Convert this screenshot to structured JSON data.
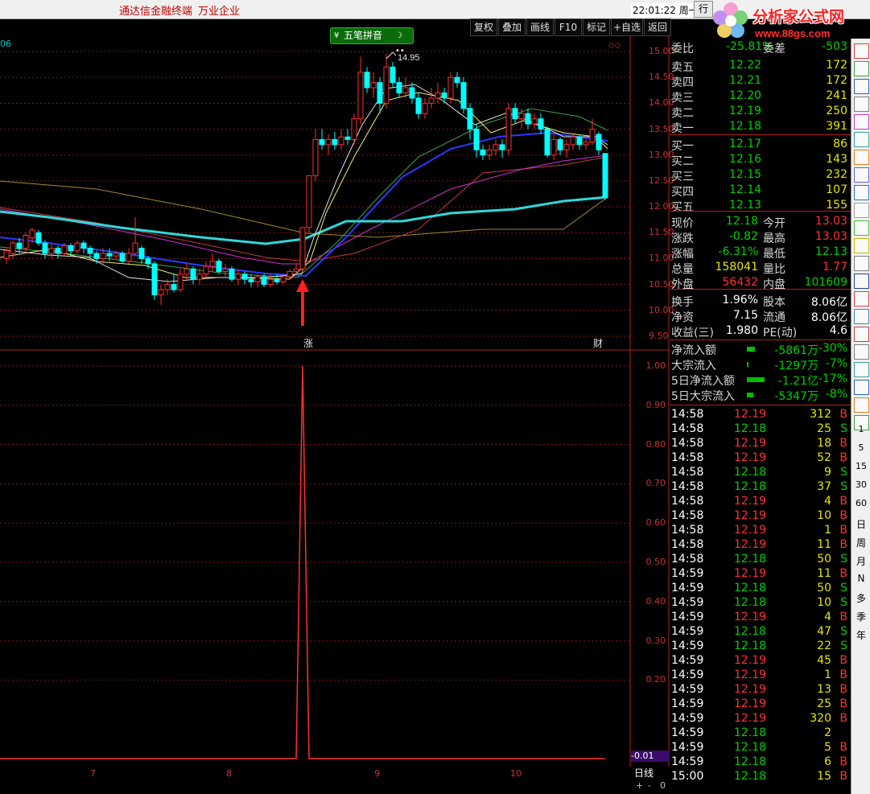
{
  "titlebar": {
    "app_name": "通达信金融终端",
    "stock_name": "万业企业",
    "clock": "22:01:22 周一",
    "trade_button": "行"
  },
  "logo": {
    "name": "分析家公式网",
    "url_text": "www.88gs.com"
  },
  "toolbar": {
    "buttons": [
      "复权",
      "叠加",
      "画线",
      "F10",
      "标记",
      "+自选",
      "返回"
    ]
  },
  "pinyin_box": {
    "label": "五笔拼音"
  },
  "indicator_value_top": "06",
  "price_axis": [
    "15.00",
    "14.50",
    "14.00",
    "13.50",
    "13.00",
    "12.50",
    "12.00",
    "11.50",
    "11.00",
    "10.50",
    "10.00",
    "9.50"
  ],
  "peak_label": "14.95",
  "signal_label": "涨",
  "cai_label": "财",
  "indicator_axis": [
    "1.00",
    "0.90",
    "0.80",
    "0.70",
    "0.60",
    "0.50",
    "0.40",
    "0.30",
    "0.20"
  ],
  "indicator_current": "-0.01",
  "date_labels": [
    "7",
    "8",
    "9",
    "10"
  ],
  "period_label": "日线",
  "zoom_controls": [
    "+",
    "-",
    "0"
  ],
  "quote": {
    "wei_bi": {
      "label": "委比",
      "value": "-25.81%",
      "label2": "委差",
      "value2": "-503"
    },
    "asks": [
      {
        "label": "卖五",
        "price": "12.22",
        "vol": "172"
      },
      {
        "label": "卖四",
        "price": "12.21",
        "vol": "172"
      },
      {
        "label": "卖三",
        "price": "12.20",
        "vol": "241"
      },
      {
        "label": "卖二",
        "price": "12.19",
        "vol": "250"
      },
      {
        "label": "卖一",
        "price": "12.18",
        "vol": "391"
      }
    ],
    "bids": [
      {
        "label": "买一",
        "price": "12.17",
        "vol": "86"
      },
      {
        "label": "买二",
        "price": "12.16",
        "vol": "143"
      },
      {
        "label": "买三",
        "price": "12.15",
        "vol": "232"
      },
      {
        "label": "买四",
        "price": "12.14",
        "vol": "107"
      },
      {
        "label": "买五",
        "price": "12.13",
        "vol": "155"
      }
    ],
    "stats": [
      {
        "l1": "现价",
        "v1": "12.18",
        "l2": "今开",
        "v2": "13.03"
      },
      {
        "l1": "涨跌",
        "v1": "-0.82",
        "l2": "最高",
        "v2": "13.03"
      },
      {
        "l1": "涨幅",
        "v1": "-6.31%",
        "l2": "最低",
        "v2": "12.13"
      },
      {
        "l1": "总量",
        "v1": "158041",
        "l2": "量比",
        "v2": "1.77"
      },
      {
        "l1": "外盘",
        "v1": "56432",
        "l2": "内盘",
        "v2": "101609"
      }
    ],
    "fundamentals": [
      {
        "l1": "换手",
        "v1": "1.96%",
        "l2": "股本",
        "v2": "8.06亿"
      },
      {
        "l1": "净资",
        "v1": "7.15",
        "l2": "流通",
        "v2": "8.06亿"
      },
      {
        "l1": "收益(三)",
        "v1": "1.980",
        "l2": "PE(动)",
        "v2": "4.6"
      }
    ],
    "flows": [
      {
        "label": "净流入额",
        "value": "-5861万",
        "pct": "-30%"
      },
      {
        "label": "大宗流入",
        "value": "-1297万",
        "pct": "-7%"
      },
      {
        "label": "5日净流入额",
        "value": "-1.21亿",
        "pct": "-17%"
      },
      {
        "label": "5日大宗流入",
        "value": "-5347万",
        "pct": "-8%"
      }
    ]
  },
  "ticks": [
    {
      "t": "14:58",
      "p": "12.19",
      "v": "312",
      "s": "B"
    },
    {
      "t": "14:58",
      "p": "12.18",
      "v": "25",
      "s": "S"
    },
    {
      "t": "14:58",
      "p": "12.19",
      "v": "18",
      "s": "B"
    },
    {
      "t": "14:58",
      "p": "12.19",
      "v": "52",
      "s": "B"
    },
    {
      "t": "14:58",
      "p": "12.18",
      "v": "9",
      "s": "S"
    },
    {
      "t": "14:58",
      "p": "12.18",
      "v": "37",
      "s": "S"
    },
    {
      "t": "14:58",
      "p": "12.19",
      "v": "4",
      "s": "B"
    },
    {
      "t": "14:58",
      "p": "12.19",
      "v": "10",
      "s": "B"
    },
    {
      "t": "14:58",
      "p": "12.19",
      "v": "1",
      "s": "B"
    },
    {
      "t": "14:58",
      "p": "12.19",
      "v": "11",
      "s": "B"
    },
    {
      "t": "14:58",
      "p": "12.18",
      "v": "50",
      "s": "S"
    },
    {
      "t": "14:59",
      "p": "12.19",
      "v": "11",
      "s": "B"
    },
    {
      "t": "14:59",
      "p": "12.18",
      "v": "50",
      "s": "S"
    },
    {
      "t": "14:59",
      "p": "12.18",
      "v": "10",
      "s": "S"
    },
    {
      "t": "14:59",
      "p": "12.19",
      "v": "4",
      "s": "B"
    },
    {
      "t": "14:59",
      "p": "12.18",
      "v": "47",
      "s": "S"
    },
    {
      "t": "14:59",
      "p": "12.18",
      "v": "22",
      "s": "S"
    },
    {
      "t": "14:59",
      "p": "12.19",
      "v": "45",
      "s": "B"
    },
    {
      "t": "14:59",
      "p": "12.19",
      "v": "1",
      "s": "B"
    },
    {
      "t": "14:59",
      "p": "12.19",
      "v": "13",
      "s": "B"
    },
    {
      "t": "14:59",
      "p": "12.19",
      "v": "25",
      "s": "B"
    },
    {
      "t": "14:59",
      "p": "12.19",
      "v": "320",
      "s": "B"
    },
    {
      "t": "14:59",
      "p": "12.18",
      "v": "2",
      "s": ""
    },
    {
      "t": "14:59",
      "p": "12.18",
      "v": "5",
      "s": "B"
    },
    {
      "t": "14:59",
      "p": "12.18",
      "v": "6",
      "s": "B"
    },
    {
      "t": "15:00",
      "p": "12.18",
      "v": "15",
      "s": "B"
    }
  ],
  "sidebar_numbers": [
    "1",
    "5",
    "15",
    "30",
    "60"
  ],
  "sidebar_periods": [
    "日",
    "周",
    "月",
    "N",
    "多",
    "季",
    "年"
  ],
  "colors": {
    "up": "#ff3030",
    "down": "#00ffff",
    "grid": "#7a1a1a",
    "indicator": "#ff3030"
  }
}
